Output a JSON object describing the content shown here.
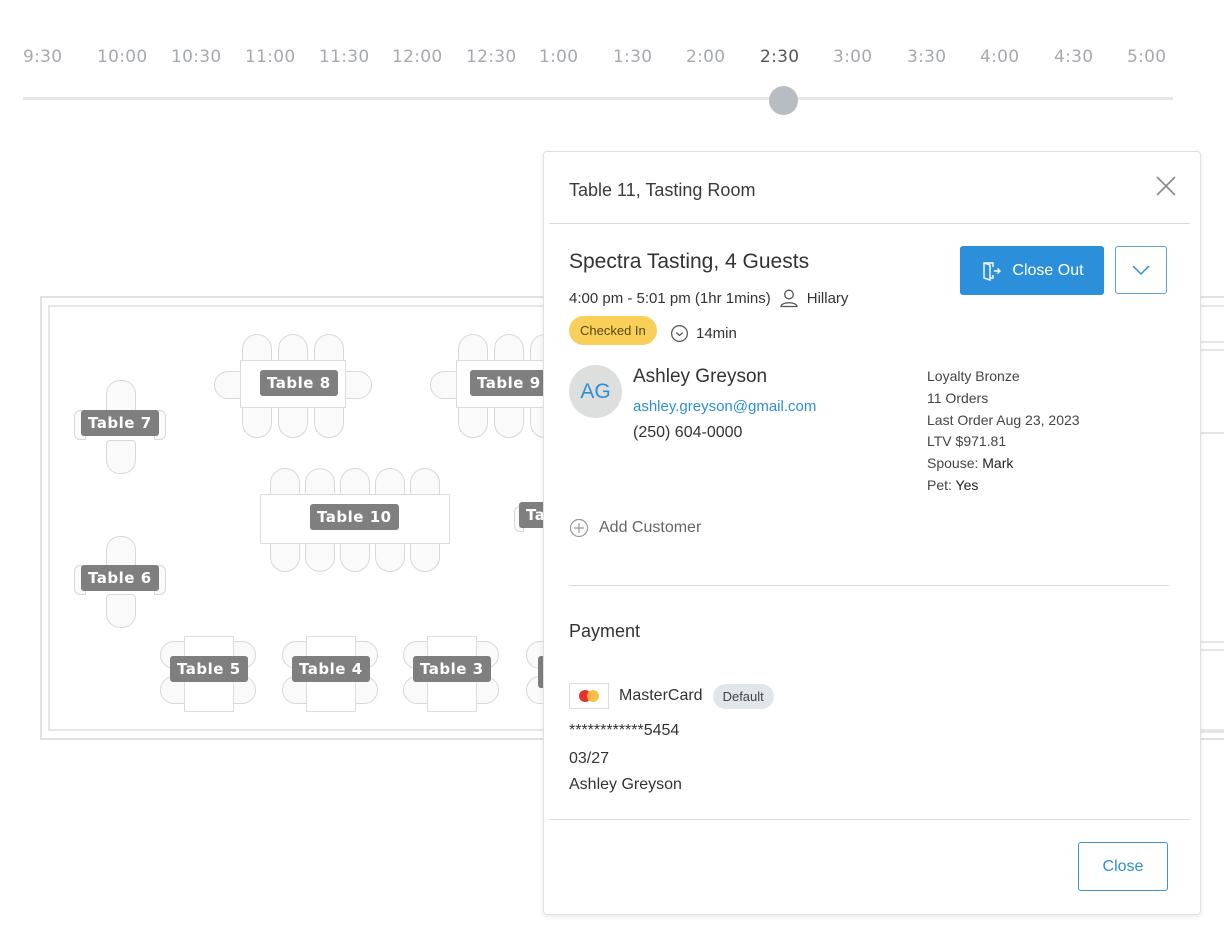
{
  "timeline": {
    "ticks": [
      "9:30",
      "10:00",
      "10:30",
      "11:00",
      "11:30",
      "12:00",
      "12:30",
      "1:00",
      "1:30",
      "2:00",
      "2:30",
      "3:00",
      "3:30",
      "4:00",
      "4:30",
      "5:00"
    ],
    "selected": "2:30"
  },
  "floor_plan": {
    "tables": [
      "Table 7",
      "Table 8",
      "Table 9",
      "Table 10",
      "Table 6",
      "Table 5",
      "Table 4",
      "Table 3",
      "Ta"
    ]
  },
  "modal": {
    "title": "Table 11, Tasting Room",
    "reservation": {
      "title": "Spectra Tasting, 4 Guests",
      "time": "4:00 pm - 5:01 pm (1hr 1mins)",
      "host": "Hillary",
      "status": "Checked In",
      "elapsed": "14min"
    },
    "actions": {
      "close_out": "Close Out"
    },
    "customer": {
      "initials": "AG",
      "name": "Ashley Greyson",
      "email": "ashley.greyson@gmail.com",
      "phone": "(250) 604-0000",
      "loyalty": "Loyalty Bronze",
      "orders": "11 Orders",
      "last_order": "Last Order Aug 23, 2023",
      "ltv": "LTV $971.81",
      "spouse_label": "Spouse:",
      "spouse": "Mark",
      "pet_label": "Pet:",
      "pet": "Yes"
    },
    "add_customer": "Add Customer",
    "payment": {
      "title": "Payment",
      "brand": "MasterCard",
      "default_badge": "Default",
      "number": "************5454",
      "expiry": "03/27",
      "holder": "Ashley Greyson"
    },
    "close_button": "Close"
  },
  "colors": {
    "primary": "#2b90d9",
    "checked_in": "#f8cf59",
    "table_label": "#7f7f7f"
  }
}
